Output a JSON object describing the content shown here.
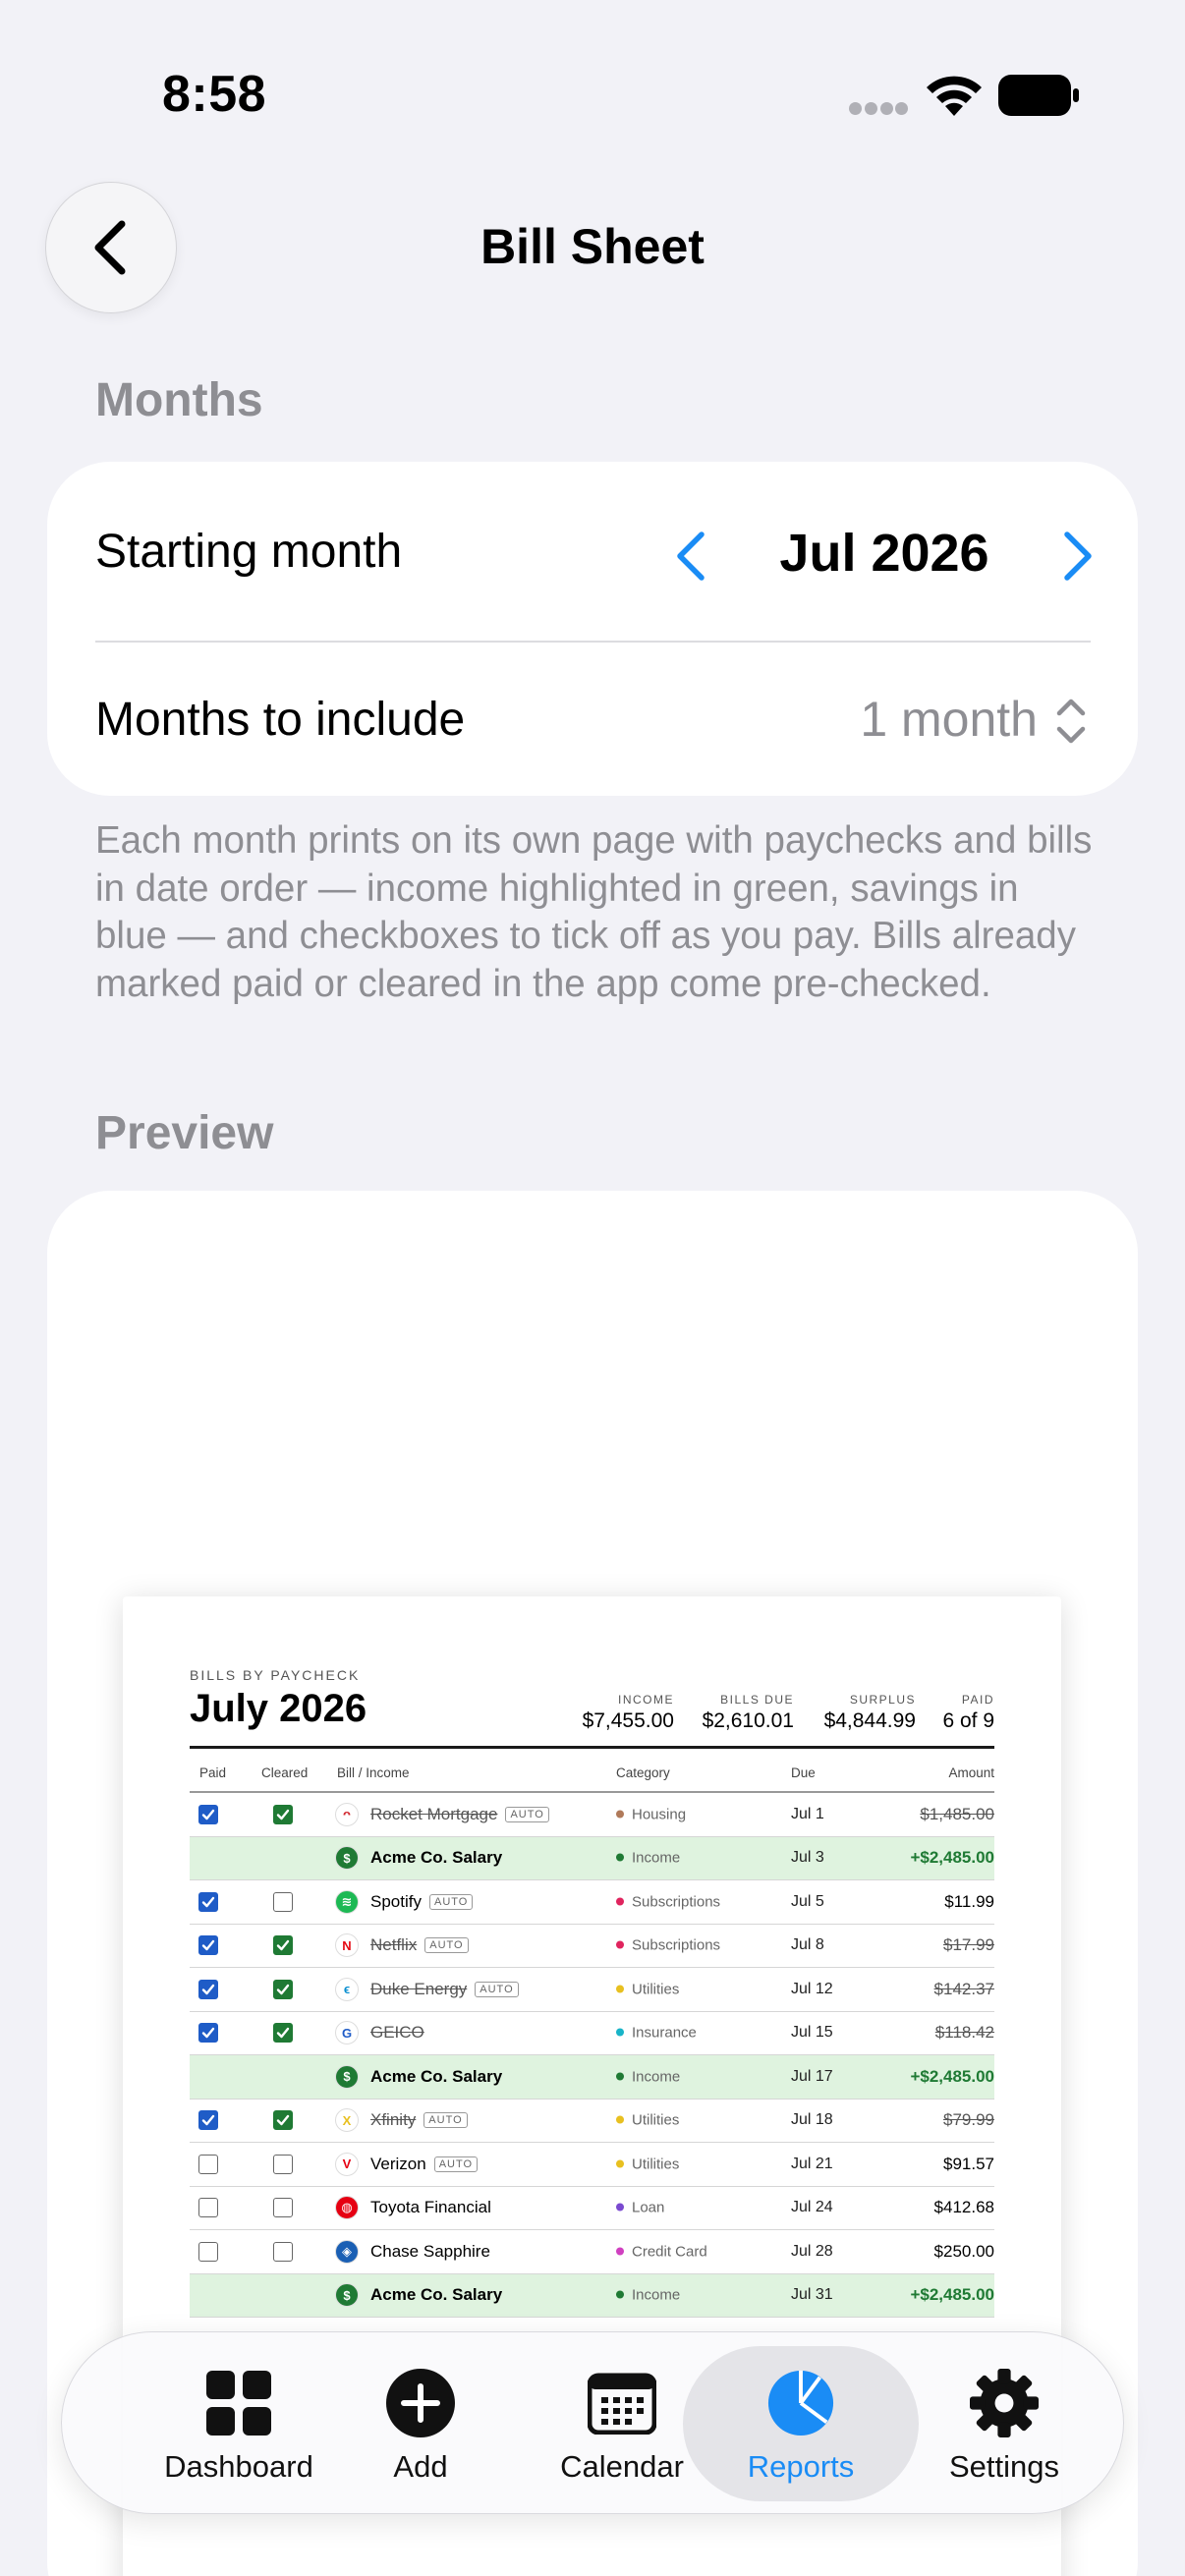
{
  "status_bar": {
    "time": "8:58"
  },
  "header": {
    "title": "Bill Sheet"
  },
  "months_section": {
    "label": "Months",
    "starting_month_label": "Starting month",
    "starting_month_value": "Jul 2026",
    "months_to_include_label": "Months to include",
    "months_to_include_value": "1 month"
  },
  "description": "Each month prints on its own page with paychecks and bills in date order — income highlighted in green, savings in blue — and checkboxes to tick off as you pay. Bills already marked paid or cleared in the app come pre-checked.",
  "preview_section": {
    "label": "Preview",
    "sheet": {
      "kicker": "BILLS BY PAYCHECK",
      "title": "July 2026",
      "stats": [
        {
          "label": "INCOME",
          "value": "$7,455.00"
        },
        {
          "label": "BILLS DUE",
          "value": "$2,610.01"
        },
        {
          "label": "SURPLUS",
          "value": "$4,844.99"
        },
        {
          "label": "PAID",
          "value": "6 of 9"
        }
      ],
      "columns": {
        "paid": "Paid",
        "cleared": "Cleared",
        "bill": "Bill / Income",
        "category": "Category",
        "due": "Due",
        "amount": "Amount"
      },
      "auto_badge": "AUTO",
      "rows": [
        {
          "name": "Rocket Mortgage",
          "auto": true,
          "category": "Housing",
          "cat_color": "#b07a5a",
          "due": "Jul 1",
          "amount": "$1,485.00",
          "paid": true,
          "cleared": true,
          "logo": "rocket-mortgage-logo",
          "logo_bg": "#ffffff",
          "logo_fg": "#d0242b",
          "logo_text": "ᴖ",
          "type": "bill"
        },
        {
          "name": "Acme Co. Salary",
          "auto": false,
          "category": "Income",
          "cat_color": "#1f7a34",
          "due": "Jul 3",
          "amount": "+$2,485.00",
          "paid": false,
          "cleared": false,
          "logo": "dollar-icon",
          "logo_bg": "#1f7a34",
          "logo_fg": "#ffffff",
          "logo_text": "$",
          "type": "income"
        },
        {
          "name": "Spotify",
          "auto": true,
          "category": "Subscriptions",
          "cat_color": "#e0245e",
          "due": "Jul 5",
          "amount": "$11.99",
          "paid": true,
          "cleared": false,
          "logo": "spotify-logo",
          "logo_bg": "#1db954",
          "logo_fg": "#ffffff",
          "logo_text": "≋",
          "type": "bill"
        },
        {
          "name": "Netflix",
          "auto": true,
          "category": "Subscriptions",
          "cat_color": "#e0245e",
          "due": "Jul 8",
          "amount": "$17.99",
          "paid": true,
          "cleared": true,
          "logo": "netflix-logo",
          "logo_bg": "#ffffff",
          "logo_fg": "#e50914",
          "logo_text": "N",
          "type": "bill"
        },
        {
          "name": "Duke Energy",
          "auto": true,
          "category": "Utilities",
          "cat_color": "#e8c020",
          "due": "Jul 12",
          "amount": "$142.37",
          "paid": true,
          "cleared": true,
          "logo": "duke-energy-logo",
          "logo_bg": "#ffffff",
          "logo_fg": "#0a8fd0",
          "logo_text": "ϵ",
          "type": "bill"
        },
        {
          "name": "GEICO",
          "auto": false,
          "category": "Insurance",
          "cat_color": "#18b4c8",
          "due": "Jul 15",
          "amount": "$118.42",
          "paid": true,
          "cleared": true,
          "logo": "geico-logo",
          "logo_bg": "#ffffff",
          "logo_fg": "#1f5cc7",
          "logo_text": "G",
          "type": "bill"
        },
        {
          "name": "Acme Co. Salary",
          "auto": false,
          "category": "Income",
          "cat_color": "#1f7a34",
          "due": "Jul 17",
          "amount": "+$2,485.00",
          "paid": false,
          "cleared": false,
          "logo": "dollar-icon",
          "logo_bg": "#1f7a34",
          "logo_fg": "#ffffff",
          "logo_text": "$",
          "type": "income"
        },
        {
          "name": "Xfinity",
          "auto": true,
          "category": "Utilities",
          "cat_color": "#e8c020",
          "due": "Jul 18",
          "amount": "$79.99",
          "paid": true,
          "cleared": true,
          "logo": "xfinity-logo",
          "logo_bg": "#ffffff",
          "logo_fg": "#e8c020",
          "logo_text": "X",
          "type": "bill"
        },
        {
          "name": "Verizon",
          "auto": true,
          "category": "Utilities",
          "cat_color": "#e8c020",
          "due": "Jul 21",
          "amount": "$91.57",
          "paid": false,
          "cleared": false,
          "logo": "verizon-logo",
          "logo_bg": "#ffffff",
          "logo_fg": "#e60012",
          "logo_text": "V",
          "type": "bill"
        },
        {
          "name": "Toyota Financial",
          "auto": false,
          "category": "Loan",
          "cat_color": "#7a4ad0",
          "due": "Jul 24",
          "amount": "$412.68",
          "paid": false,
          "cleared": false,
          "logo": "toyota-logo",
          "logo_bg": "#e60012",
          "logo_fg": "#ffffff",
          "logo_text": "◍",
          "type": "bill"
        },
        {
          "name": "Chase Sapphire",
          "auto": false,
          "category": "Credit Card",
          "cat_color": "#d040c0",
          "due": "Jul 28",
          "amount": "$250.00",
          "paid": false,
          "cleared": false,
          "logo": "chase-logo",
          "logo_bg": "#1a5fb4",
          "logo_fg": "#ffffff",
          "logo_text": "◈",
          "type": "bill"
        },
        {
          "name": "Acme Co. Salary",
          "auto": false,
          "category": "Income",
          "cat_color": "#1f7a34",
          "due": "Jul 31",
          "amount": "+$2,485.00",
          "paid": false,
          "cleared": false,
          "logo": "dollar-icon",
          "logo_bg": "#1f7a34",
          "logo_fg": "#ffffff",
          "logo_text": "$",
          "type": "income"
        }
      ]
    }
  },
  "tabbar": {
    "accent": "#1a8cf5",
    "tabs": [
      {
        "label": "Dashboard",
        "icon": "grid-icon",
        "active": false
      },
      {
        "label": "Add",
        "icon": "plus-circle-icon",
        "active": false
      },
      {
        "label": "Calendar",
        "icon": "calendar-icon",
        "active": false
      },
      {
        "label": "Reports",
        "icon": "pie-chart-icon",
        "active": true
      },
      {
        "label": "Settings",
        "icon": "gear-icon",
        "active": false
      }
    ]
  }
}
